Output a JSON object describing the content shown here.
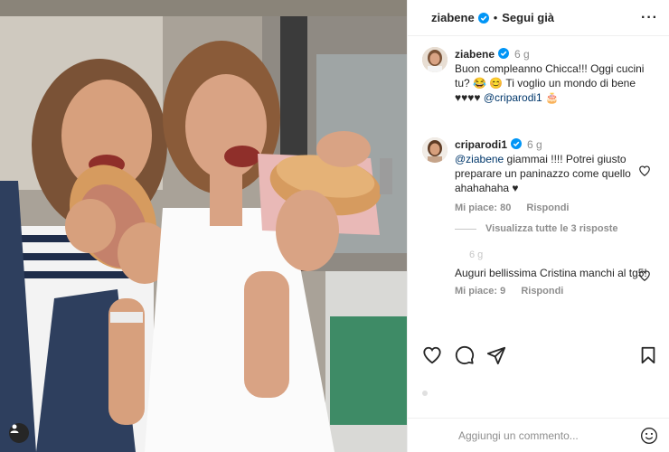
{
  "post": {
    "image_description_icon": "photo-of-two-women-biting-sandwiches",
    "user_tag_icon": "user-tag-icon"
  },
  "header": {
    "username": "ziabene",
    "separator": "•",
    "follow_label": "Segui già",
    "more_icon": "more-options-icon",
    "more_label": "···"
  },
  "caption": {
    "username": "ziabene",
    "time": "6 g",
    "text_before": "Buon compleanno Chicca!!! Oggi cucini tu? 😂 😊 Ti voglio un mondo di bene ♥♥♥♥ ",
    "mention": "@criparodi1",
    "text_after": " 🎂"
  },
  "comments": [
    {
      "username": "criparodi1",
      "time": "6 g",
      "mention": "@ziabene",
      "text": " giammai !!!! Potrei giusto preparare un paninazzo come quello ahahahaha ♥",
      "likes_label": "Mi piace: 80",
      "reply_label": "Rispondi"
    },
    {
      "username": "",
      "time": "6 g",
      "text": "Auguri bellissima Cristina manchi al tg5!",
      "likes_label": "Mi piace: 9",
      "reply_label": "Rispondi"
    }
  ],
  "view_replies_label": "Visualizza tutte le 3 risposte",
  "actions": {
    "like_icon": "heart-icon",
    "comment_icon": "comment-icon",
    "share_icon": "share-icon",
    "save_icon": "bookmark-icon"
  },
  "add_comment": {
    "placeholder": "Aggiungi un commento...",
    "emoji_icon": "emoji-icon"
  },
  "colors": {
    "verified_blue": "#0095f6",
    "text": "#262626",
    "secondary": "#8e8e8e",
    "mention": "#00376b"
  }
}
